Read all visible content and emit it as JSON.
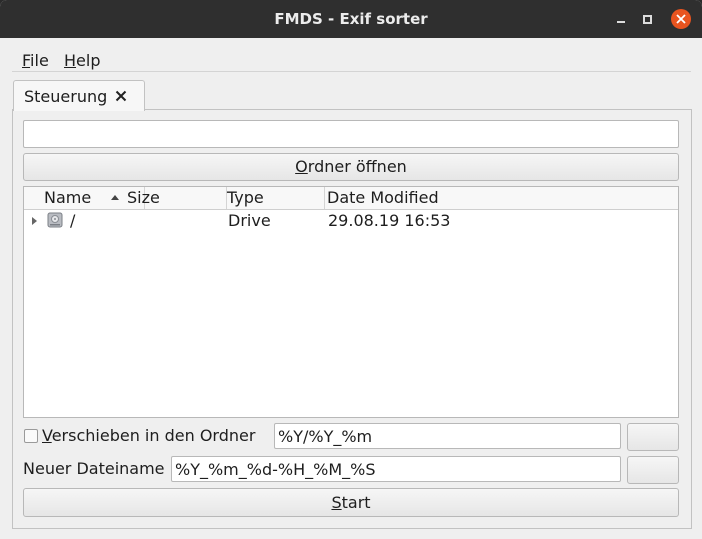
{
  "window": {
    "title": "FMDS - Exif sorter",
    "controls": [
      "minimize-icon",
      "maximize-icon",
      "close-icon"
    ],
    "close_color": "#e9541f"
  },
  "menu": {
    "file_first": "F",
    "file_rest": "ile",
    "help_first": "H",
    "help_rest": "elp"
  },
  "tab": {
    "label": "Steuerung"
  },
  "path_input": {
    "value": ""
  },
  "open_button": {
    "first": "O",
    "rest": "rdner öffnen"
  },
  "tree": {
    "columns": [
      "Name",
      "Size",
      "Type",
      "Date Modified"
    ],
    "rows": [
      {
        "name": "/",
        "size": "",
        "type": "Drive",
        "date": "29.08.19 16:53",
        "icon": "drive-icon"
      }
    ]
  },
  "move": {
    "checked": false,
    "label_first": "V",
    "label_rest": "erschieben in den Ordner",
    "pattern": "%Y/%Y_%m"
  },
  "rename": {
    "label": "Neuer Dateiname",
    "pattern": "%Y_%m_%d-%H_%M_%S"
  },
  "start_button": {
    "first": "S",
    "rest": "tart"
  }
}
